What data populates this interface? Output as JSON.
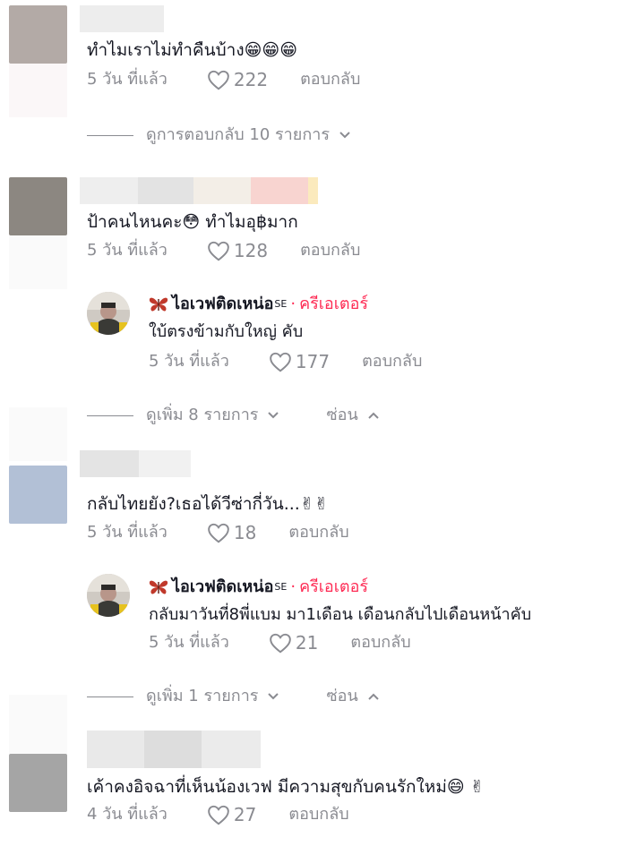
{
  "comments": [
    {
      "text": "ทำไมเราไม่ทำคืนบ้าง😁😁😁",
      "time": "5 วัน ที่แล้ว",
      "likes": "222",
      "reply_label": "ตอบกลับ",
      "expander": {
        "more_label": "ดูการตอบกลับ 10 รายการ"
      }
    },
    {
      "text": "ป้าคนไหนคะ😳 ทำไมอุ฿มาก",
      "time": "5 วัน ที่แล้ว",
      "likes": "128",
      "reply_label": "ตอบกลับ",
      "reply": {
        "author": "ไอเวฟติดเหน่อ",
        "author_suffix": "SE",
        "badge": "ครีเอเตอร์",
        "text": "ใบ้ตรงข้ามกับใหญ่ คับ",
        "time": "5 วัน ที่แล้ว",
        "likes": "177",
        "reply_label": "ตอบกลับ"
      },
      "expander": {
        "more_label": "ดูเพิ่ม 8 รายการ",
        "hide_label": "ซ่อน"
      }
    },
    {
      "text": "กลับไทยยัง?เธอได้วีซ่ากี่วัน...✌✌",
      "time": "5 วัน ที่แล้ว",
      "likes": "18",
      "reply_label": "ตอบกลับ",
      "reply": {
        "author": "ไอเวฟติดเหน่อ",
        "author_suffix": "SE",
        "badge": "ครีเอเตอร์",
        "text": "กลับมาวันที่8พี่แบม มา1เดือน เดือนกลับไปเดือนหน้าคับ",
        "time": "5 วัน ที่แล้ว",
        "likes": "21",
        "reply_label": "ตอบกลับ"
      },
      "expander": {
        "more_label": "ดูเพิ่ม 1 รายการ",
        "hide_label": "ซ่อน"
      }
    },
    {
      "text": "เค้าคงอิจฉาที่เห็นน้องเวฟ มีความสุขกับคนรักใหม่😄 ✌",
      "time": "4 วัน ที่แล้ว",
      "likes": "27",
      "reply_label": "ตอบกลับ"
    }
  ],
  "colors": {
    "text": "#161823",
    "secondary": "#8a8b91",
    "creator_badge": "#fe2c55"
  },
  "icons": {
    "like": "heart-outline-icon",
    "expand": "chevron-down-icon",
    "collapse": "chevron-up-icon",
    "author_emoji": "butterfly-icon"
  }
}
